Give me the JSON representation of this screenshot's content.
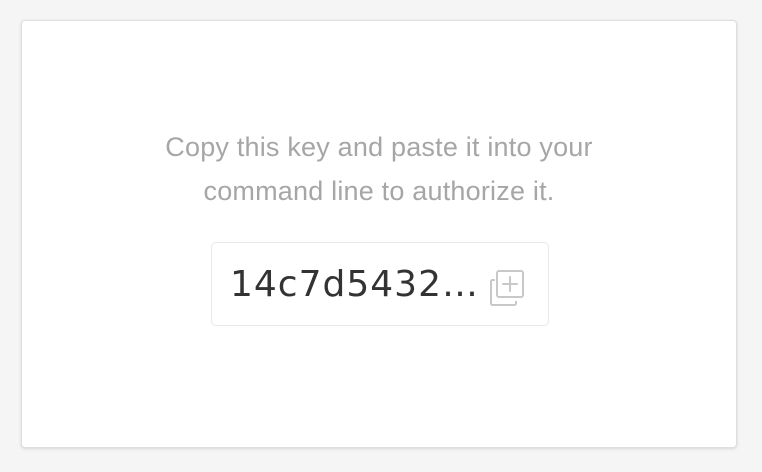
{
  "instructions": {
    "line1": "Copy this key and paste it into your",
    "line2": "command line to authorize it."
  },
  "api_key": {
    "display": "14c7d54326..."
  },
  "icons": {
    "copy": "copy-plus-icon"
  },
  "colors": {
    "instruction_text": "#a6a6a6",
    "key_text": "#333333",
    "icon": "#c8c8c8"
  }
}
